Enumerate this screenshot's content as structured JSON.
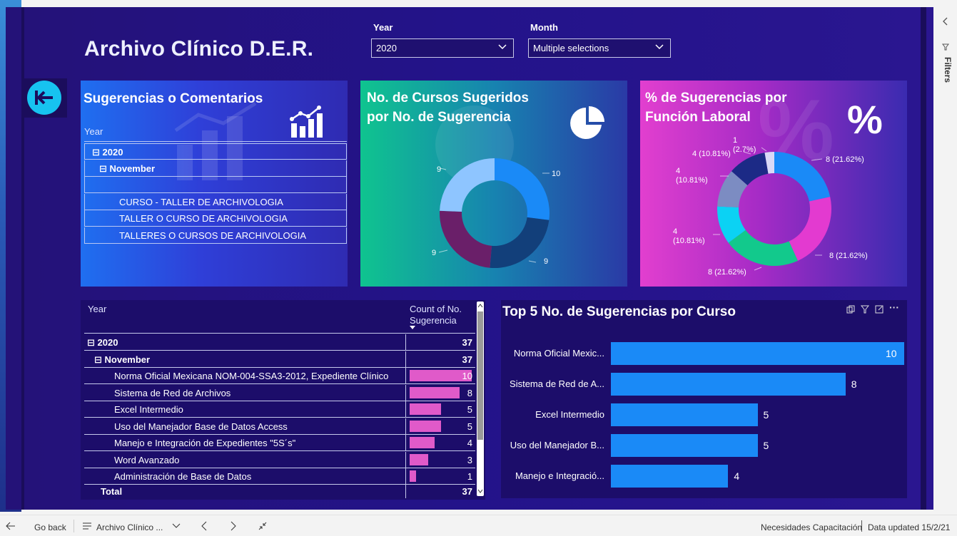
{
  "report": {
    "title": "Archivo Clínico D.E.R."
  },
  "slicers": {
    "year": {
      "label": "Year",
      "value": "2020"
    },
    "month": {
      "label": "Month",
      "value": "Multiple selections"
    }
  },
  "card_sugerencias": {
    "title": "Sugerencias o Comentarios",
    "header": "Year",
    "rows": [
      {
        "text": "⊟ 2020"
      },
      {
        "text": "⊟ November"
      },
      {
        "text": ""
      },
      {
        "text": "CURSO - TALLER DE ARCHIVOLOGIA"
      },
      {
        "text": "TALLER O CURSO DE ARCHIVOLOGIA"
      },
      {
        "text": "TALLERES O CURSOS DE ARCHIVOLOGIA"
      }
    ]
  },
  "card_cursos": {
    "title_line1": "No. de Cursos Sugeridos",
    "title_line2": "por No. de Sugerencia"
  },
  "card_funcion": {
    "title_line1": "% de Sugerencias por",
    "title_line2": "Función Laboral"
  },
  "chart_data": [
    {
      "type": "pie",
      "title": "No. de Cursos Sugeridos por No. de Sugerencia",
      "values": [
        10,
        9,
        9,
        9
      ],
      "labels": [
        "10",
        "9",
        "9",
        "9"
      ],
      "colors": [
        "#1a8af7",
        "#123f7a",
        "#6a1f69",
        "#8ec5ff"
      ]
    },
    {
      "type": "pie",
      "title": "% de Sugerencias por Función Laboral",
      "values": [
        8,
        8,
        8,
        4,
        4,
        4,
        1
      ],
      "labels": [
        "8 (21.62%)",
        "8 (21.62%)",
        "8 (21.62%)",
        "4 (10.81%)",
        "4 (10.81%)",
        "4 (10.81%)",
        "1 (2.7%)"
      ],
      "colors": [
        "#1a8af7",
        "#e33ad0",
        "#12c98c",
        "#0bd2f4",
        "#7c8cc2",
        "#1c2a86",
        "#d9d9f7"
      ]
    },
    {
      "type": "bar",
      "title": "Top 5 No. de Sugerencias por Curso",
      "categories": [
        "Norma Oficial Mexic...",
        "Sistema de Red de A...",
        "Excel Intermedio",
        "Uso del Manejador B...",
        "Manejo e Integració..."
      ],
      "values": [
        10,
        8,
        5,
        5,
        4
      ],
      "color": "#1a8af7"
    }
  ],
  "table": {
    "col_year": "Year",
    "col_count": "Count of No. Sugerencia",
    "rows": [
      {
        "label": "⊟ 2020",
        "value": "37",
        "bold": true,
        "indent": 0
      },
      {
        "label": "⊟ November",
        "value": "37",
        "bold": true,
        "indent": 1
      },
      {
        "label": "Norma Oficial Mexicana NOM-004-SSA3-2012, Expediente Clínico",
        "value": "10",
        "bar": 10,
        "indent": 2
      },
      {
        "label": "Sistema de Red de Archivos",
        "value": "8",
        "bar": 8,
        "indent": 2
      },
      {
        "label": "Excel Intermedio",
        "value": "5",
        "bar": 5,
        "indent": 2
      },
      {
        "label": "Uso del Manejador Base de Datos Access",
        "value": "5",
        "bar": 5,
        "indent": 2
      },
      {
        "label": "Manejo e Integración de Expedientes \"5S´s\"",
        "value": "4",
        "bar": 4,
        "indent": 2
      },
      {
        "label": "Word Avanzado",
        "value": "3",
        "bar": 3,
        "indent": 2
      },
      {
        "label": "Administración de Base de Datos",
        "value": "1",
        "bar": 1,
        "indent": 2
      }
    ],
    "total_label": "Total",
    "total_value": "37"
  },
  "statusbar": {
    "back": "Go back",
    "page": "Archivo Clínico ...",
    "page_name": "Necesidades Capacitación",
    "updated": "Data updated 15/2/21"
  },
  "filters_pane": {
    "label": "Filters"
  }
}
